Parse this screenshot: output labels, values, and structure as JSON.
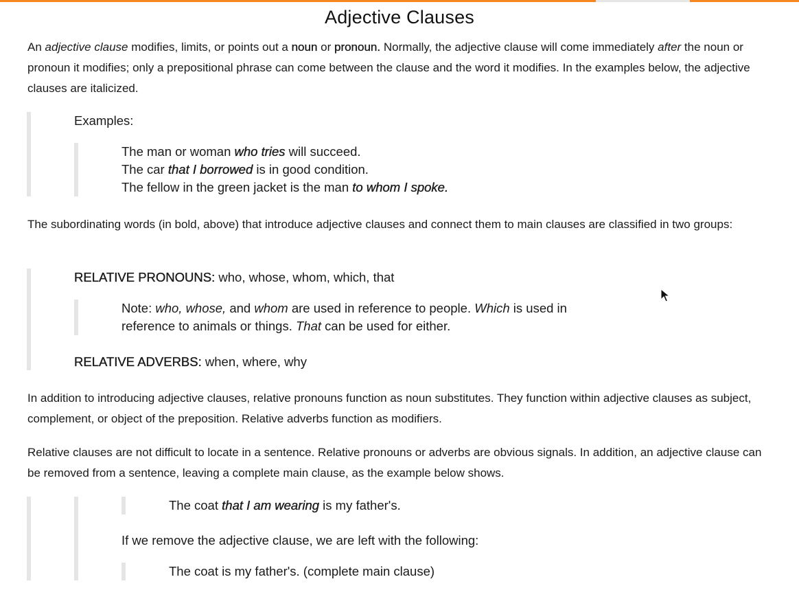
{
  "progress": {
    "colors": {
      "progress": "#f6861f",
      "track": "#e6e6e6",
      "quote_bar": "#e5e5e5"
    }
  },
  "title": "Adjective Clauses",
  "intro": {
    "t1": "An ",
    "t2": "adjective clause",
    "t3": " modifies, limits, or points out a ",
    "t4": "noun",
    "t5": " or ",
    "t6": "pronoun.",
    "t7": " Normally, the adjective clause will come immediately ",
    "t8": "after",
    "t9": " the noun or pronoun it modifies; only a prepositional phrase can come between the clause and the word it modifies. In the examples below, the adjective clauses are italicized."
  },
  "examples": {
    "label": "Examples:",
    "ex1": {
      "a": "The man or woman ",
      "b": "who tries",
      "c": " will succeed."
    },
    "ex2": {
      "a": "The car ",
      "b": "that I borrowed",
      "c": " is in good condition."
    },
    "ex3": {
      "a": "The fellow in the green jacket is the man ",
      "b": "to whom I spoke."
    }
  },
  "subordinating": "The subordinating words (in bold, above) that introduce adjective clauses and connect them to main clauses are classified in two groups:",
  "groups": {
    "pronouns_label": "RELATIVE PRONOUNS:",
    "pronouns_text": " who, whose, whom, which, that",
    "note": {
      "a": "Note: ",
      "b": "who, whose,",
      "c": " and ",
      "d": "whom",
      "e": " are used in reference to people. ",
      "f": "Which",
      "g": " is used in",
      "h": "reference to animals or things. ",
      "i": "That",
      "j": " can be used for either."
    },
    "adverbs_label": "RELATIVE ADVERBS:",
    "adverbs_text": " when, where, why"
  },
  "addition": "In addition to introducing adjective clauses, relative pronouns function as noun substitutes. They function within adjective clauses as subject, complement, or object of the preposition. Relative adverbs function as modifiers.",
  "locate": "Relative clauses are not difficult to locate in a sentence. Relative pronouns or adverbs are obvious signals. In addition, an adjective clause can be removed from a sentence, leaving a complete main clause, as the example below shows.",
  "coat": {
    "a": "The coat ",
    "b": "that I am wearing",
    "c": " is my father's.",
    "remove": "If we remove the adjective clause, we are left with the following:",
    "result": "The coat is my father's. (complete main clause)"
  },
  "icons": {
    "cursor": "mouse-pointer-icon"
  }
}
